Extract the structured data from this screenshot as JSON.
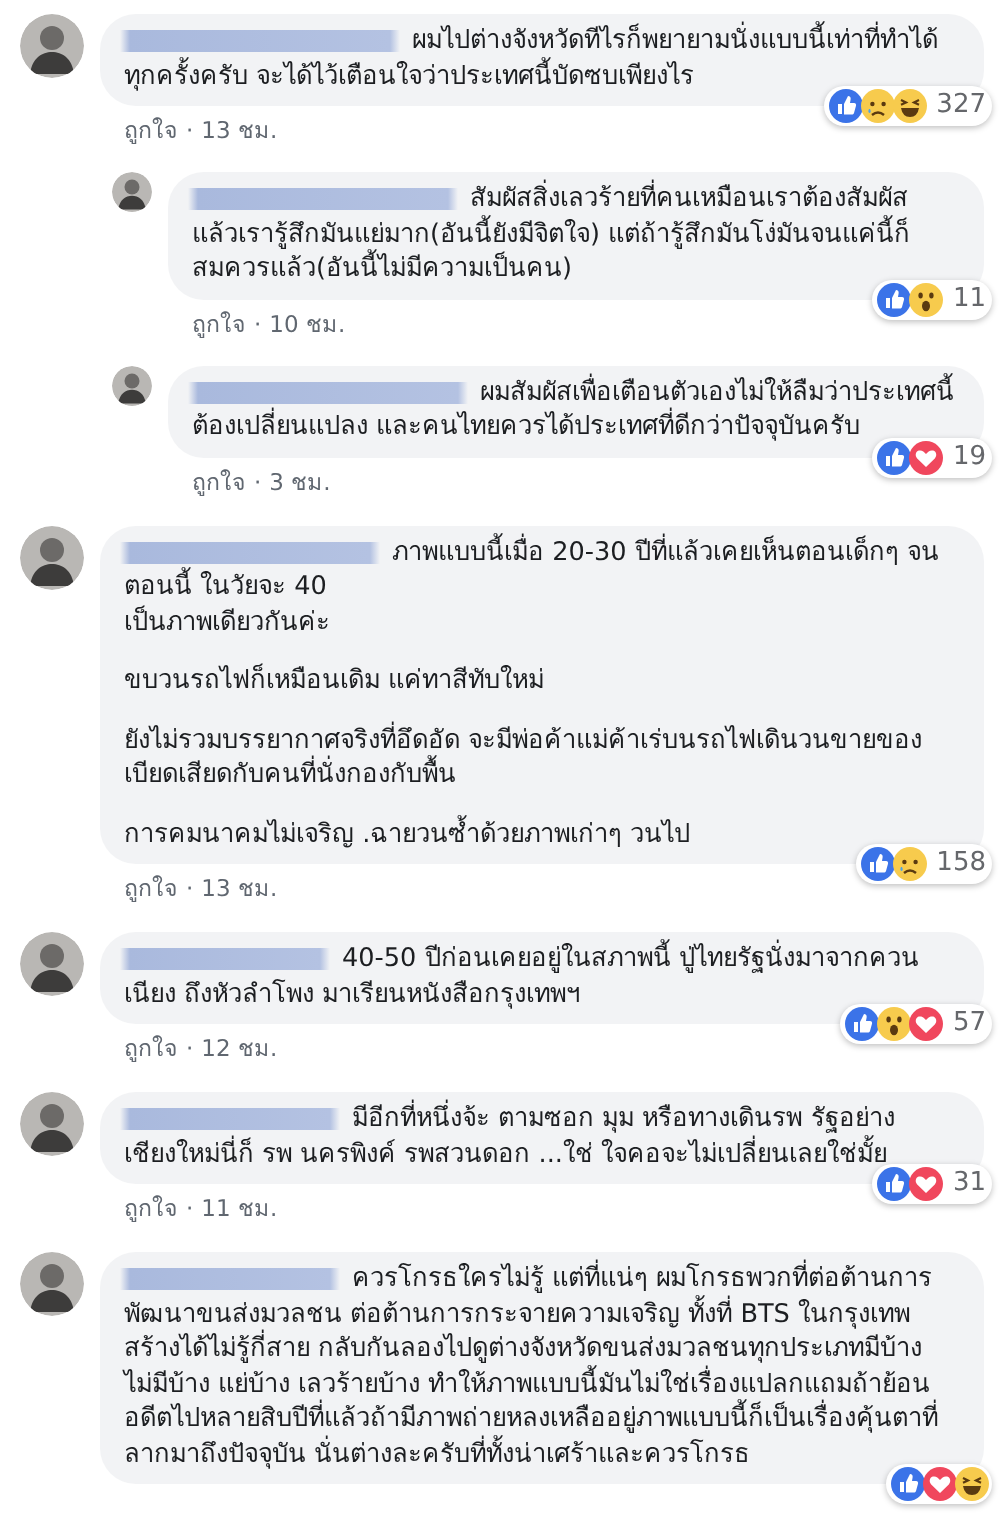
{
  "comments": [
    {
      "paragraphs": [
        "ผมไปต่างจังหวัดทีไรก็พยายามนั่งแบบนี้เท่าที่ทำได้ทุกครั้งครับ จะได้ไว้เตือนใจว่าประเทศนี้บัดซบเพียงไร"
      ],
      "reactions": [
        {
          "kind": "like"
        },
        {
          "kind": "sad"
        },
        {
          "kind": "haha"
        }
      ],
      "count": "327",
      "like_label": "ถูกใจ",
      "separator": "·",
      "time": "13 ชม.",
      "replies": [
        {
          "paragraphs": [
            "สัมผัสสิ่งเลวร้ายที่คนเหมือนเราต้องสัมผัส แล้วเรารู้สึกมันแย่มาก(อันนี้ยังมีจิตใจ) แต่ถ้ารู้สึกมันโง่มันจนแค่นี้ก็สมควรแล้ว(อันนี้ไม่มีความเป็นคน)"
          ],
          "reactions": [
            {
              "kind": "like"
            },
            {
              "kind": "wow"
            }
          ],
          "count": "11",
          "like_label": "ถูกใจ",
          "separator": "·",
          "time": "10 ชม."
        },
        {
          "paragraphs": [
            "ผมสัมผัสเพื่อเตือนตัวเองไม่ให้ลืมว่าประเทศนี้ต้องเปลี่ยนแปลง และคนไทยควรได้ประเทศที่ดีกว่าปัจจุบันครับ"
          ],
          "reactions": [
            {
              "kind": "like"
            },
            {
              "kind": "love"
            }
          ],
          "count": "19",
          "like_label": "ถูกใจ",
          "separator": "·",
          "time": "3 ชม."
        }
      ]
    },
    {
      "paragraphs": [
        "ภาพแบบนี้เมื่อ 20-30 ปีที่แล้วเคยเห็นตอนเด็กๆ จนตอนนี้ ในวัยจะ 40\nเป็นภาพเดียวกันค่ะ",
        "ขบวนรถไฟก็เหมือนเดิม แค่ทาสีทับใหม่",
        "ยังไม่รวมบรรยากาศจริงที่อึดอัด จะมีพ่อค้าแม่ค้าเร่บนรถไฟเดินวนขายของเบียดเสียดกับคนที่นั่งกองกับพื้น",
        "การคมนาคมไม่เจริญ .ฉายวนซ้ำด้วยภาพเก่าๆ วนไป"
      ],
      "reactions": [
        {
          "kind": "like"
        },
        {
          "kind": "sad"
        }
      ],
      "count": "158",
      "like_label": "ถูกใจ",
      "separator": "·",
      "time": "13 ชม."
    },
    {
      "paragraphs": [
        "40-50 ปีก่อนเคยอยู่ในสภาพนี้ ปู่ไทยรัฐนั่งมาจากควนเนียง ถึงหัวลำโพง มาเรียนหนังสือกรุงเทพฯ"
      ],
      "reactions": [
        {
          "kind": "like"
        },
        {
          "kind": "wow"
        },
        {
          "kind": "love"
        }
      ],
      "count": "57",
      "like_label": "ถูกใจ",
      "separator": "·",
      "time": "12 ชม."
    },
    {
      "paragraphs": [
        "มีอีกที่หนึ่งจ้ะ ตามซอก มุม หรือทางเดินรพ รัฐอย่างเชียงใหม่นี่ก็ รพ นครพิงค์ รพสวนดอก ...ใช่ ใจคอจะไม่เปลี่ยนเลยใช่มั้ย"
      ],
      "reactions": [
        {
          "kind": "like"
        },
        {
          "kind": "love"
        }
      ],
      "count": "31",
      "like_label": "ถูกใจ",
      "separator": "·",
      "time": "11 ชม."
    },
    {
      "paragraphs": [
        "ควรโกรธใครไม่รู้ แต่ที่แน่ๆ ผมโกรธพวกที่ต่อต้านการพัฒนาขนส่งมวลชน ต่อต้านการกระจายความเจริญ ทั้งที่ BTS ในกรุงเทพสร้างได้ไม่รู้กี่สาย กลับกันลองไปดูต่างจังหวัดขนส่งมวลชนทุกประเภทมีบ้างไม่มีบ้าง แย่บ้าง เลวร้ายบ้าง ทำให้ภาพแบบนี้มันไม่ใช่เรื่องแปลกแถมถ้าย้อนอดีตไปหลายสิบปีที่แล้วถ้ามีภาพถ่ายหลงเหลืออยู่ภาพแบบนี้ก็เป็นเรื่องคุ้นตาที่ลากมาถึงปัจจุบัน นั่นต่างละครับที่ทั้งน่าเศร้าและควรโกรธ"
      ],
      "reactions": [
        {
          "kind": "like"
        },
        {
          "kind": "love"
        },
        {
          "kind": "haha"
        }
      ]
    }
  ]
}
